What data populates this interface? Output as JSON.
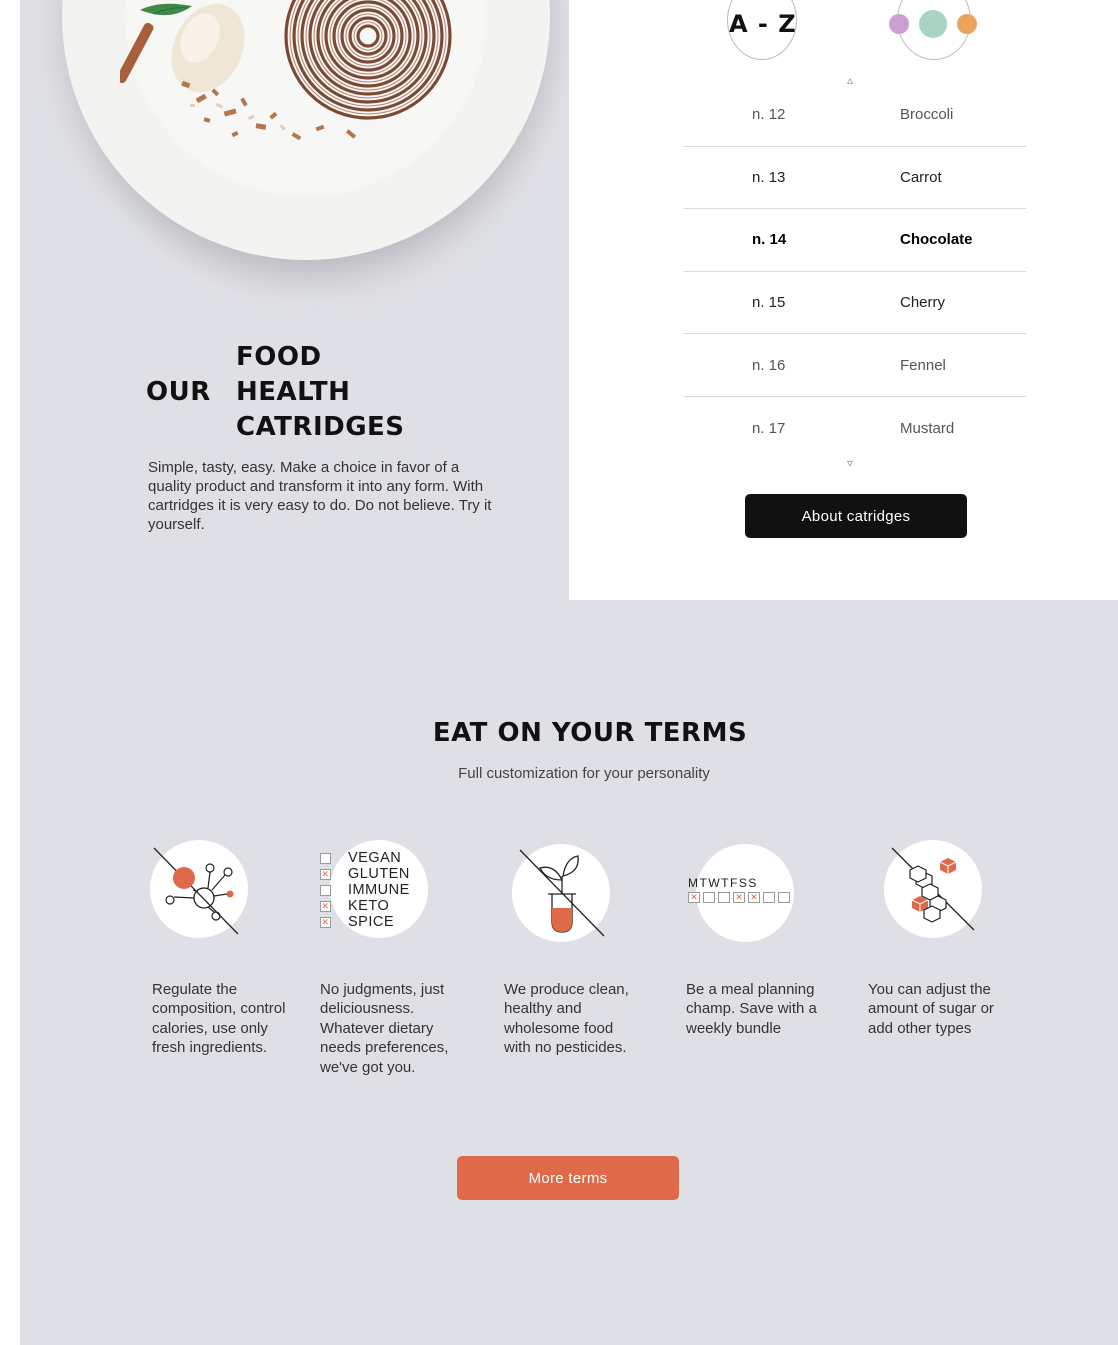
{
  "hero": {
    "title_food": "FOOD",
    "title_our": "OUR",
    "title_health": "HEALTH",
    "title_catridges": "CATRIDGES",
    "description": "Simple, tasty, easy. Make a choice in favor of a quality product and transform it into any form. With cartridges it is very easy to do. Do not believe. Try it yourself."
  },
  "catalog": {
    "sort_label": "A - Z",
    "scroll_up_icon": "triangle-up-icon",
    "scroll_down_icon": "triangle-down-icon",
    "color_dots": [
      "#c9a0cf",
      "#a9d3c3",
      "#eba35c"
    ],
    "items": [
      {
        "num": "n. 12",
        "name": "Broccoli"
      },
      {
        "num": "n. 13",
        "name": "Carrot"
      },
      {
        "num": "n. 14",
        "name": "Chocolate"
      },
      {
        "num": "n. 15",
        "name": "Cherry"
      },
      {
        "num": "n. 16",
        "name": "Fennel"
      },
      {
        "num": "n. 17",
        "name": "Mustard"
      }
    ],
    "about_button": "About catridges"
  },
  "terms": {
    "title": "EAT ON YOUR TERMS",
    "subtitle": "Full customization for your personality",
    "diet_options": [
      "VEGAN",
      "GLUTEN",
      "IMMUNE",
      "KETO",
      "SPICE"
    ],
    "week_days": "MTWTFSS",
    "features": [
      {
        "icon": "molecule-icon",
        "text": "Regulate the composition, control calories, use only fresh ingredients."
      },
      {
        "icon": "diet-checklist-icon",
        "text": "No judgments, just deliciousness. Whatever dietary needs preferences, we've got you."
      },
      {
        "icon": "sprout-test-tube-icon",
        "text": "We produce clean, healthy and wholesome food with no pesticides."
      },
      {
        "icon": "weekly-calendar-icon",
        "text": "Be a meal planning champ. Save with a weekly bundle"
      },
      {
        "icon": "cubes-icon",
        "text": "You can adjust the amount of sugar or add other types"
      }
    ],
    "more_button": "More terms"
  },
  "colors": {
    "accent": "#df6a4a",
    "background_grey": "#dfe0e5",
    "dark_button": "#111111"
  }
}
